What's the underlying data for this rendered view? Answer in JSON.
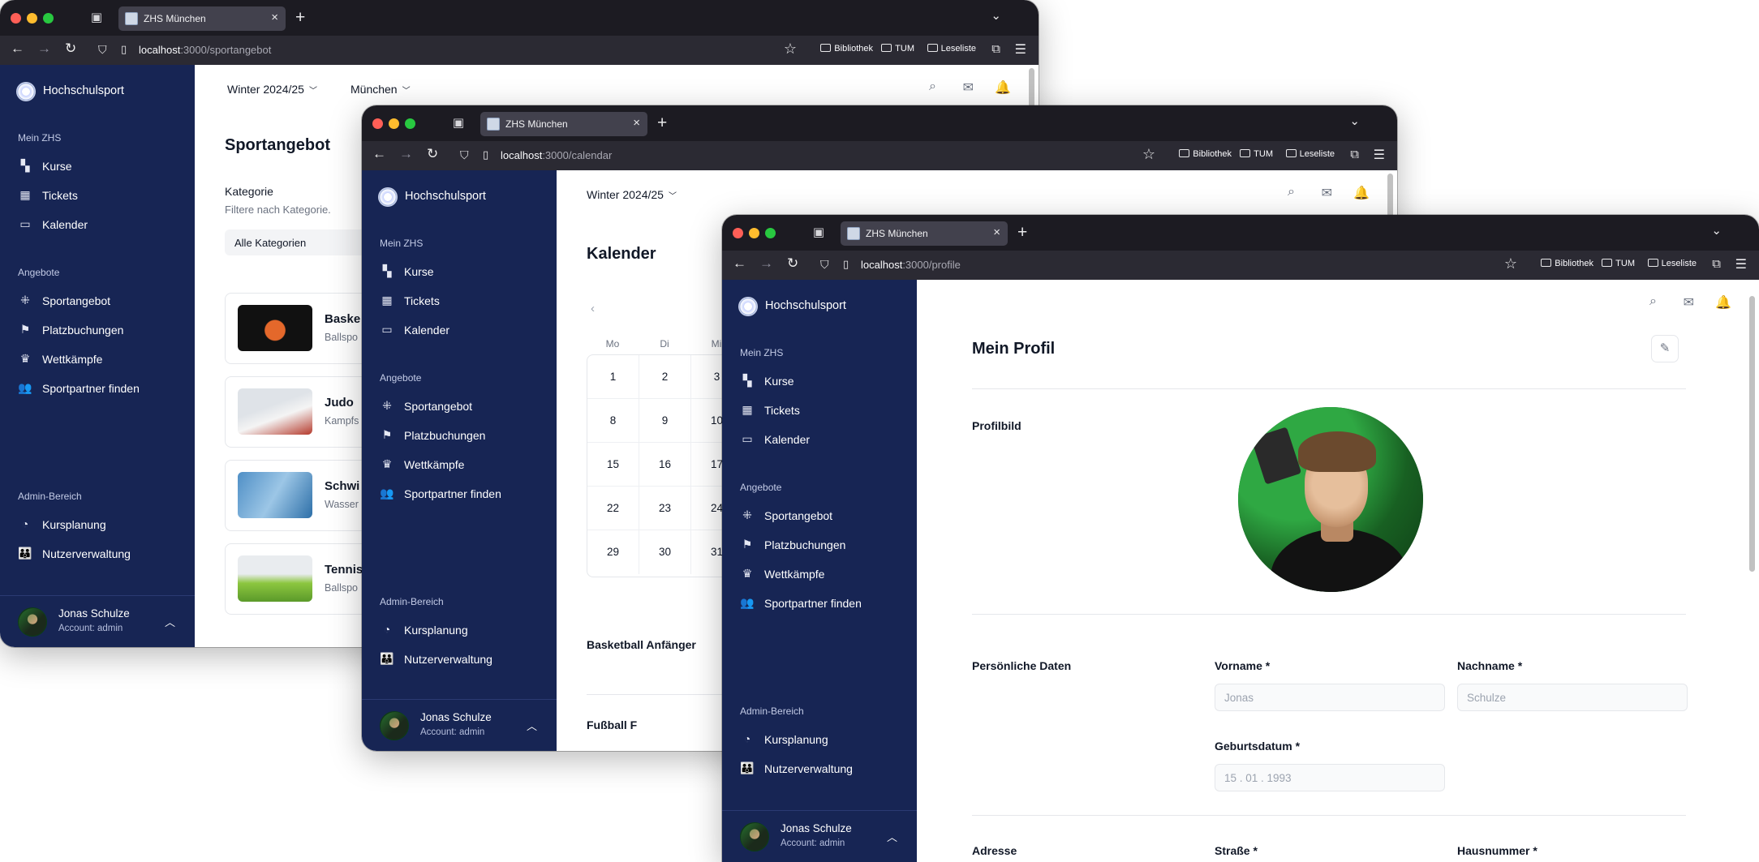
{
  "browser": {
    "tab_title": "ZHS München",
    "url_host": "localhost",
    "bookmarks": [
      "Bibliothek",
      "TUM",
      "Leseliste"
    ]
  },
  "sidebar": {
    "brand": "Hochschulsport",
    "sections": {
      "mein_zhs": "Mein ZHS",
      "angebote": "Angebote",
      "admin": "Admin-Bereich"
    },
    "mein_zhs_items": [
      {
        "label": "Kurse",
        "icon": "courses-icon"
      },
      {
        "label": "Tickets",
        "icon": "qr-ticket-icon"
      },
      {
        "label": "Kalender",
        "icon": "calendar-icon"
      }
    ],
    "angebote_items": [
      {
        "label": "Sportangebot",
        "icon": "grid-plus-icon"
      },
      {
        "label": "Platzbuchungen",
        "icon": "flag-icon"
      },
      {
        "label": "Wettkämpfe",
        "icon": "trophy-icon"
      },
      {
        "label": "Sportpartner finden",
        "icon": "users-icon"
      }
    ],
    "admin_items": [
      {
        "label": "Kursplanung",
        "icon": "planning-icon"
      },
      {
        "label": "Nutzerverwaltung",
        "icon": "group-icon"
      }
    ],
    "user": {
      "name": "Jonas Schulze",
      "role": "Account: admin"
    }
  },
  "windows": {
    "sportangebot": {
      "url_path": ":3000/sportangebot",
      "semester": "Winter 2024/25",
      "location": "München",
      "title": "Sportangebot",
      "filter_label": "Kategorie",
      "filter_sub": "Filtere nach Kategorie.",
      "filter_value": "Alle Kategorien",
      "cards": [
        {
          "title": "Baske",
          "sub": "Ballspo"
        },
        {
          "title": "Judo",
          "sub": "Kampfs"
        },
        {
          "title": "Schwi",
          "sub": "Wasser"
        },
        {
          "title": "Tennis",
          "sub": "Ballspo"
        }
      ]
    },
    "calendar": {
      "url_path": ":3000/calendar",
      "semester": "Winter 2024/25",
      "title": "Kalender",
      "weekdays": [
        "Mo",
        "Di",
        "Mi"
      ],
      "days": [
        [
          "1",
          "2",
          "3"
        ],
        [
          "8",
          "9",
          "10"
        ],
        [
          "15",
          "16",
          "17"
        ],
        [
          "22",
          "23",
          "24"
        ],
        [
          "29",
          "30",
          "31"
        ]
      ],
      "events": [
        "Basketball Anfänger",
        "Fußball F"
      ]
    },
    "profile": {
      "url_path": ":3000/profile",
      "title": "Mein Profil",
      "photo_label": "Profilbild",
      "personal_label": "Persönliche Daten",
      "vorname_label": "Vorname *",
      "vorname_value": "Jonas",
      "nachname_label": "Nachname *",
      "nachname_value": "Schulze",
      "geburtsdatum_label": "Geburtsdatum *",
      "geburtsdatum_value": "15 . 01 . 1993",
      "adresse_label": "Adresse",
      "strasse_label": "Straße *",
      "hausnummer_label": "Hausnummer *"
    }
  }
}
